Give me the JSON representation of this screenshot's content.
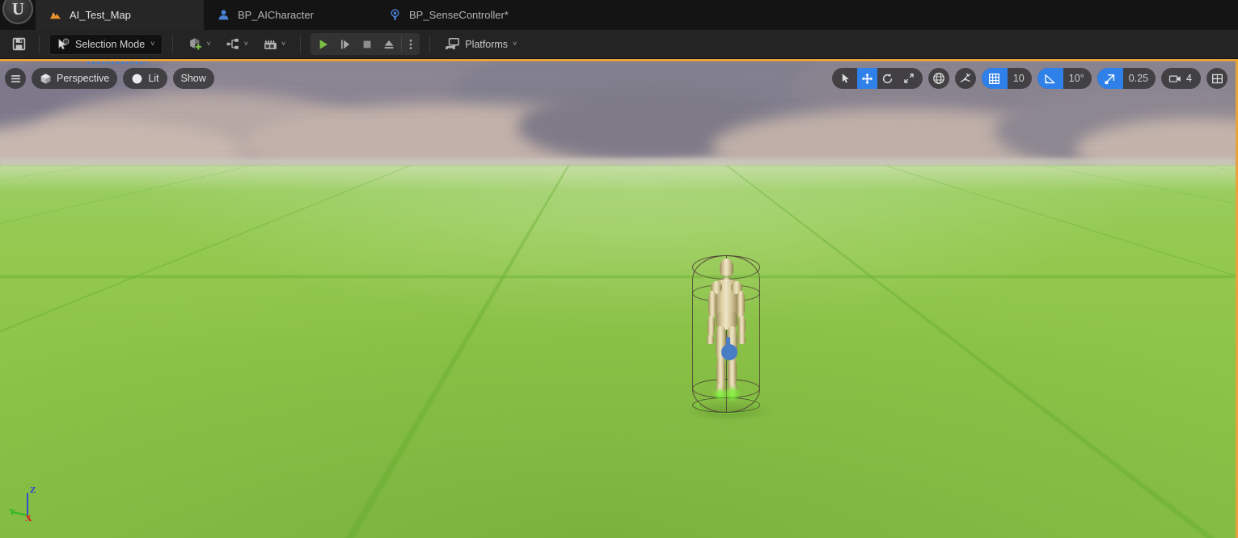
{
  "app": {
    "logo_glyph": "U",
    "logo_name": "unreal-engine-logo"
  },
  "tabs": [
    {
      "label": "AI_Test_Map",
      "icon": "landscape-map-icon",
      "active": true,
      "modified": false
    },
    {
      "label": "BP_AICharacter",
      "icon": "blueprint-character-icon",
      "active": false,
      "modified": false
    },
    {
      "label": "BP_SenseController*",
      "icon": "blueprint-actor-icon",
      "active": false,
      "modified": true
    }
  ],
  "toolbar": {
    "save_label": "Save",
    "save_icon": "save-disk-icon",
    "mode_label": "Selection Mode",
    "mode_icon": "select-cursor-icon",
    "add_label": "Add",
    "add_icon": "add-actor-icon",
    "blueprints_label": "Blueprints",
    "blueprints_icon": "blueprint-graph-icon",
    "cinematics_label": "Cinematics",
    "cinematics_icon": "film-slate-icon",
    "play_label": "Play",
    "play_icon": "play-icon",
    "skip_label": "Skip",
    "skip_icon": "step-frame-icon",
    "stop_label": "Stop",
    "stop_icon": "stop-square-icon",
    "eject_label": "Eject",
    "eject_icon": "eject-icon",
    "options_label": "Play Options",
    "options_icon": "kebab-menu-icon",
    "platforms_label": "Platforms",
    "platforms_icon": "platforms-device-icon",
    "chevron": "˅"
  },
  "viewport": {
    "menu_icon": "hamburger-menu-icon",
    "view_mode_label": "Perspective",
    "view_mode_icon": "cube-icon",
    "lighting_label": "Lit",
    "lighting_icon": "lit-sphere-icon",
    "show_label": "Show",
    "transform_tools": [
      {
        "name": "select-tool",
        "icon": "cursor-arrow-icon",
        "active": false
      },
      {
        "name": "translate-tool",
        "icon": "move-arrows-icon",
        "active": true
      },
      {
        "name": "rotate-tool",
        "icon": "rotate-icon",
        "active": false
      },
      {
        "name": "scale-tool",
        "icon": "scale-icon",
        "active": false
      }
    ],
    "coordinate_system_icon": "world-globe-icon",
    "surface_snap_icon": "surface-snap-icon",
    "grid_snap": {
      "icon": "grid-snap-icon",
      "value": "10",
      "enabled": true
    },
    "angle_snap": {
      "icon": "angle-snap-icon",
      "value": "10°",
      "enabled": true
    },
    "scale_snap": {
      "icon": "scale-snap-icon",
      "value": "0.25",
      "enabled": true
    },
    "camera_speed": {
      "icon": "camera-speed-icon",
      "value": "4"
    },
    "maximize_icon": "viewport-layout-icon",
    "axis_gizmo": {
      "x_label": "X",
      "x_color": "#d42b2b",
      "y_label": "Y",
      "y_color": "#22b822",
      "z_label": "Z",
      "z_color": "#2b44d4"
    },
    "scene": {
      "selected_actor": "BP_AICharacter",
      "selection_outline_color": "#78eb3c",
      "capsule_color": "#4e4233",
      "marker_color": "#4a7ec4"
    }
  },
  "colors": {
    "accent_blue": "#2f80e8",
    "active_viewport_border": "#e8a33d",
    "play_green": "#7cc043",
    "tab_bar_bg": "#141414",
    "toolbar_bg": "#242424",
    "ground_green": "#8dc548"
  }
}
